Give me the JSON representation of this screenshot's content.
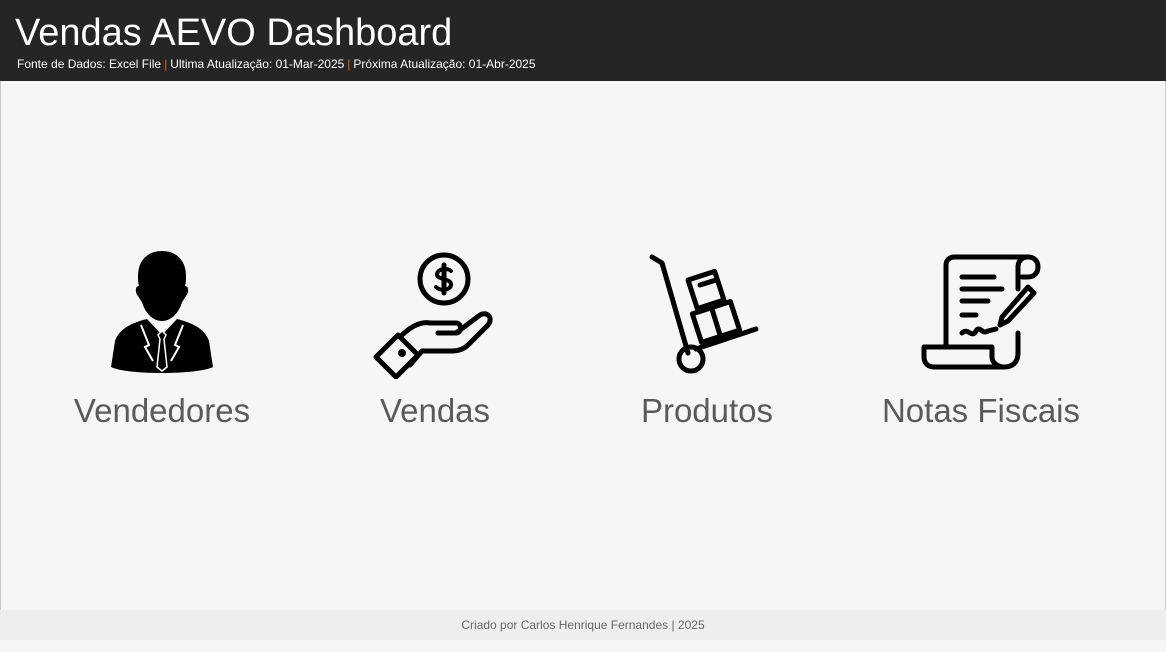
{
  "header": {
    "title": "Vendas AEVO Dashboard",
    "data_source": "Fonte de Dados: Excel File",
    "separator_1": "|",
    "last_update": "Ultima Atualização: 01-Mar-2025",
    "separator_2": "|",
    "next_update": "Próxima Atualização: 01-Abr-2025",
    "separator_color": "#e8601c"
  },
  "tiles": [
    {
      "label": "Vendedores",
      "icon": "businessman-icon"
    },
    {
      "label": "Vendas",
      "icon": "hand-holding-money-icon"
    },
    {
      "label": "Produtos",
      "icon": "hand-truck-boxes-icon"
    },
    {
      "label": "Notas Fiscais",
      "icon": "invoice-scroll-icon"
    }
  ],
  "footer": {
    "credit": "Criado por Carlos Henrique Fernandes | 2025"
  }
}
